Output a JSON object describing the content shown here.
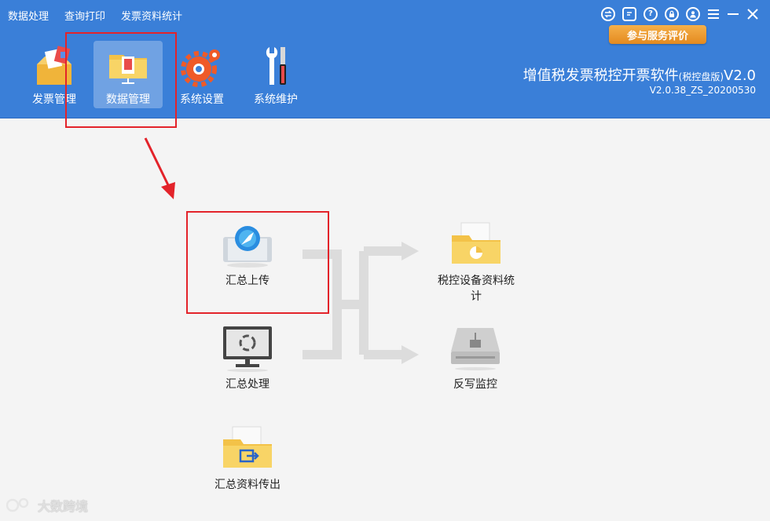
{
  "menu": {
    "items": [
      "数据处理",
      "查询打印",
      "发票资料统计"
    ]
  },
  "window_controls": {
    "icons": [
      "switch-icon",
      "feedback-icon",
      "help-icon",
      "lock-icon",
      "user-icon",
      "menu-icon",
      "minimize-icon",
      "close-icon"
    ]
  },
  "service_button": {
    "label": "参与服务评价"
  },
  "toolbar": {
    "items": [
      {
        "label": "发票管理",
        "icon": "invoice-box-icon"
      },
      {
        "label": "数据管理",
        "icon": "data-folder-icon",
        "active": true
      },
      {
        "label": "系统设置",
        "icon": "gear-icon"
      },
      {
        "label": "系统维护",
        "icon": "tools-icon"
      }
    ]
  },
  "app": {
    "title": "增值税发票税控开票软件",
    "edition": "(税控盘版)",
    "ver_suffix": "V2.0",
    "version": "V2.0.38_ZS_20200530"
  },
  "functions": {
    "summary_upload": {
      "label": "汇总上传",
      "icon": "upload-compass-icon"
    },
    "summary_process": {
      "label": "汇总处理",
      "icon": "monitor-refresh-icon"
    },
    "summary_export": {
      "label": "汇总资料传出",
      "icon": "folder-export-icon"
    },
    "device_stats": {
      "label": "税控设备资料统计",
      "icon": "folder-chart-icon"
    },
    "writeback": {
      "label": "反写监控",
      "icon": "disk-drive-icon"
    }
  },
  "watermark": {
    "text": "大数跨境"
  },
  "colors": {
    "header_bg": "#3a7fd8",
    "accent_orange": "#e48a1f",
    "annotation_red": "#e3232a"
  }
}
